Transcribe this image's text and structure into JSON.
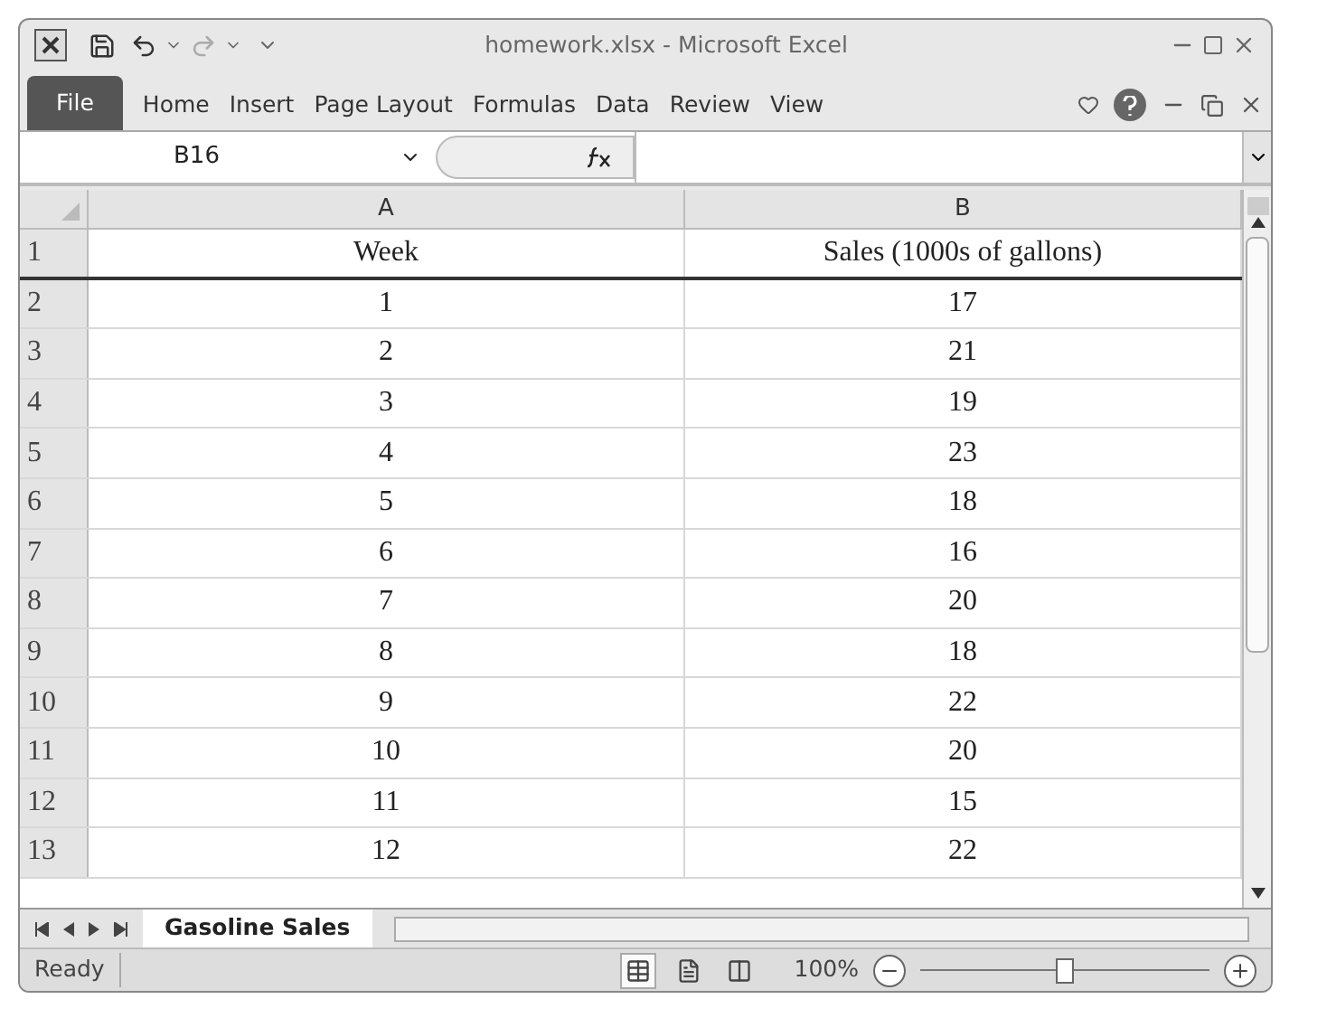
{
  "window": {
    "title": "homework.xlsx  -  Microsoft Excel"
  },
  "ribbon_tabs": [
    {
      "label": "File",
      "kind": "file"
    },
    {
      "label": "Home",
      "kind": "tab"
    },
    {
      "label": "Insert",
      "kind": "tab"
    },
    {
      "label": "Page Layout",
      "kind": "tab"
    },
    {
      "label": "Formulas",
      "kind": "tab"
    },
    {
      "label": "Data",
      "kind": "tab"
    },
    {
      "label": "Review",
      "kind": "tab"
    },
    {
      "label": "View",
      "kind": "tab"
    }
  ],
  "name_box": {
    "value": "B16"
  },
  "columns": [
    "A",
    "B"
  ],
  "rows": [
    {
      "number": "1",
      "cells": [
        "Week",
        "Sales (1000s of gallons)"
      ]
    },
    {
      "number": "2",
      "cells": [
        "1",
        "17"
      ]
    },
    {
      "number": "3",
      "cells": [
        "2",
        "21"
      ]
    },
    {
      "number": "4",
      "cells": [
        "3",
        "19"
      ]
    },
    {
      "number": "5",
      "cells": [
        "4",
        "23"
      ]
    },
    {
      "number": "6",
      "cells": [
        "5",
        "18"
      ]
    },
    {
      "number": "7",
      "cells": [
        "6",
        "16"
      ]
    },
    {
      "number": "8",
      "cells": [
        "7",
        "20"
      ]
    },
    {
      "number": "9",
      "cells": [
        "8",
        "18"
      ]
    },
    {
      "number": "10",
      "cells": [
        "9",
        "22"
      ]
    },
    {
      "number": "11",
      "cells": [
        "10",
        "20"
      ]
    },
    {
      "number": "12",
      "cells": [
        "11",
        "15"
      ]
    },
    {
      "number": "13",
      "cells": [
        "12",
        "22"
      ]
    }
  ],
  "sheet_tabs": [
    {
      "label": "Gasoline Sales",
      "selected": true
    }
  ],
  "status_bar": {
    "status": "Ready",
    "views": [
      {
        "kind": "normal",
        "selected": true
      },
      {
        "kind": "layout",
        "selected": false
      },
      {
        "kind": "break",
        "selected": false
      }
    ],
    "zoom": "100%",
    "zoom_slider": {
      "level": 0.5
    }
  }
}
